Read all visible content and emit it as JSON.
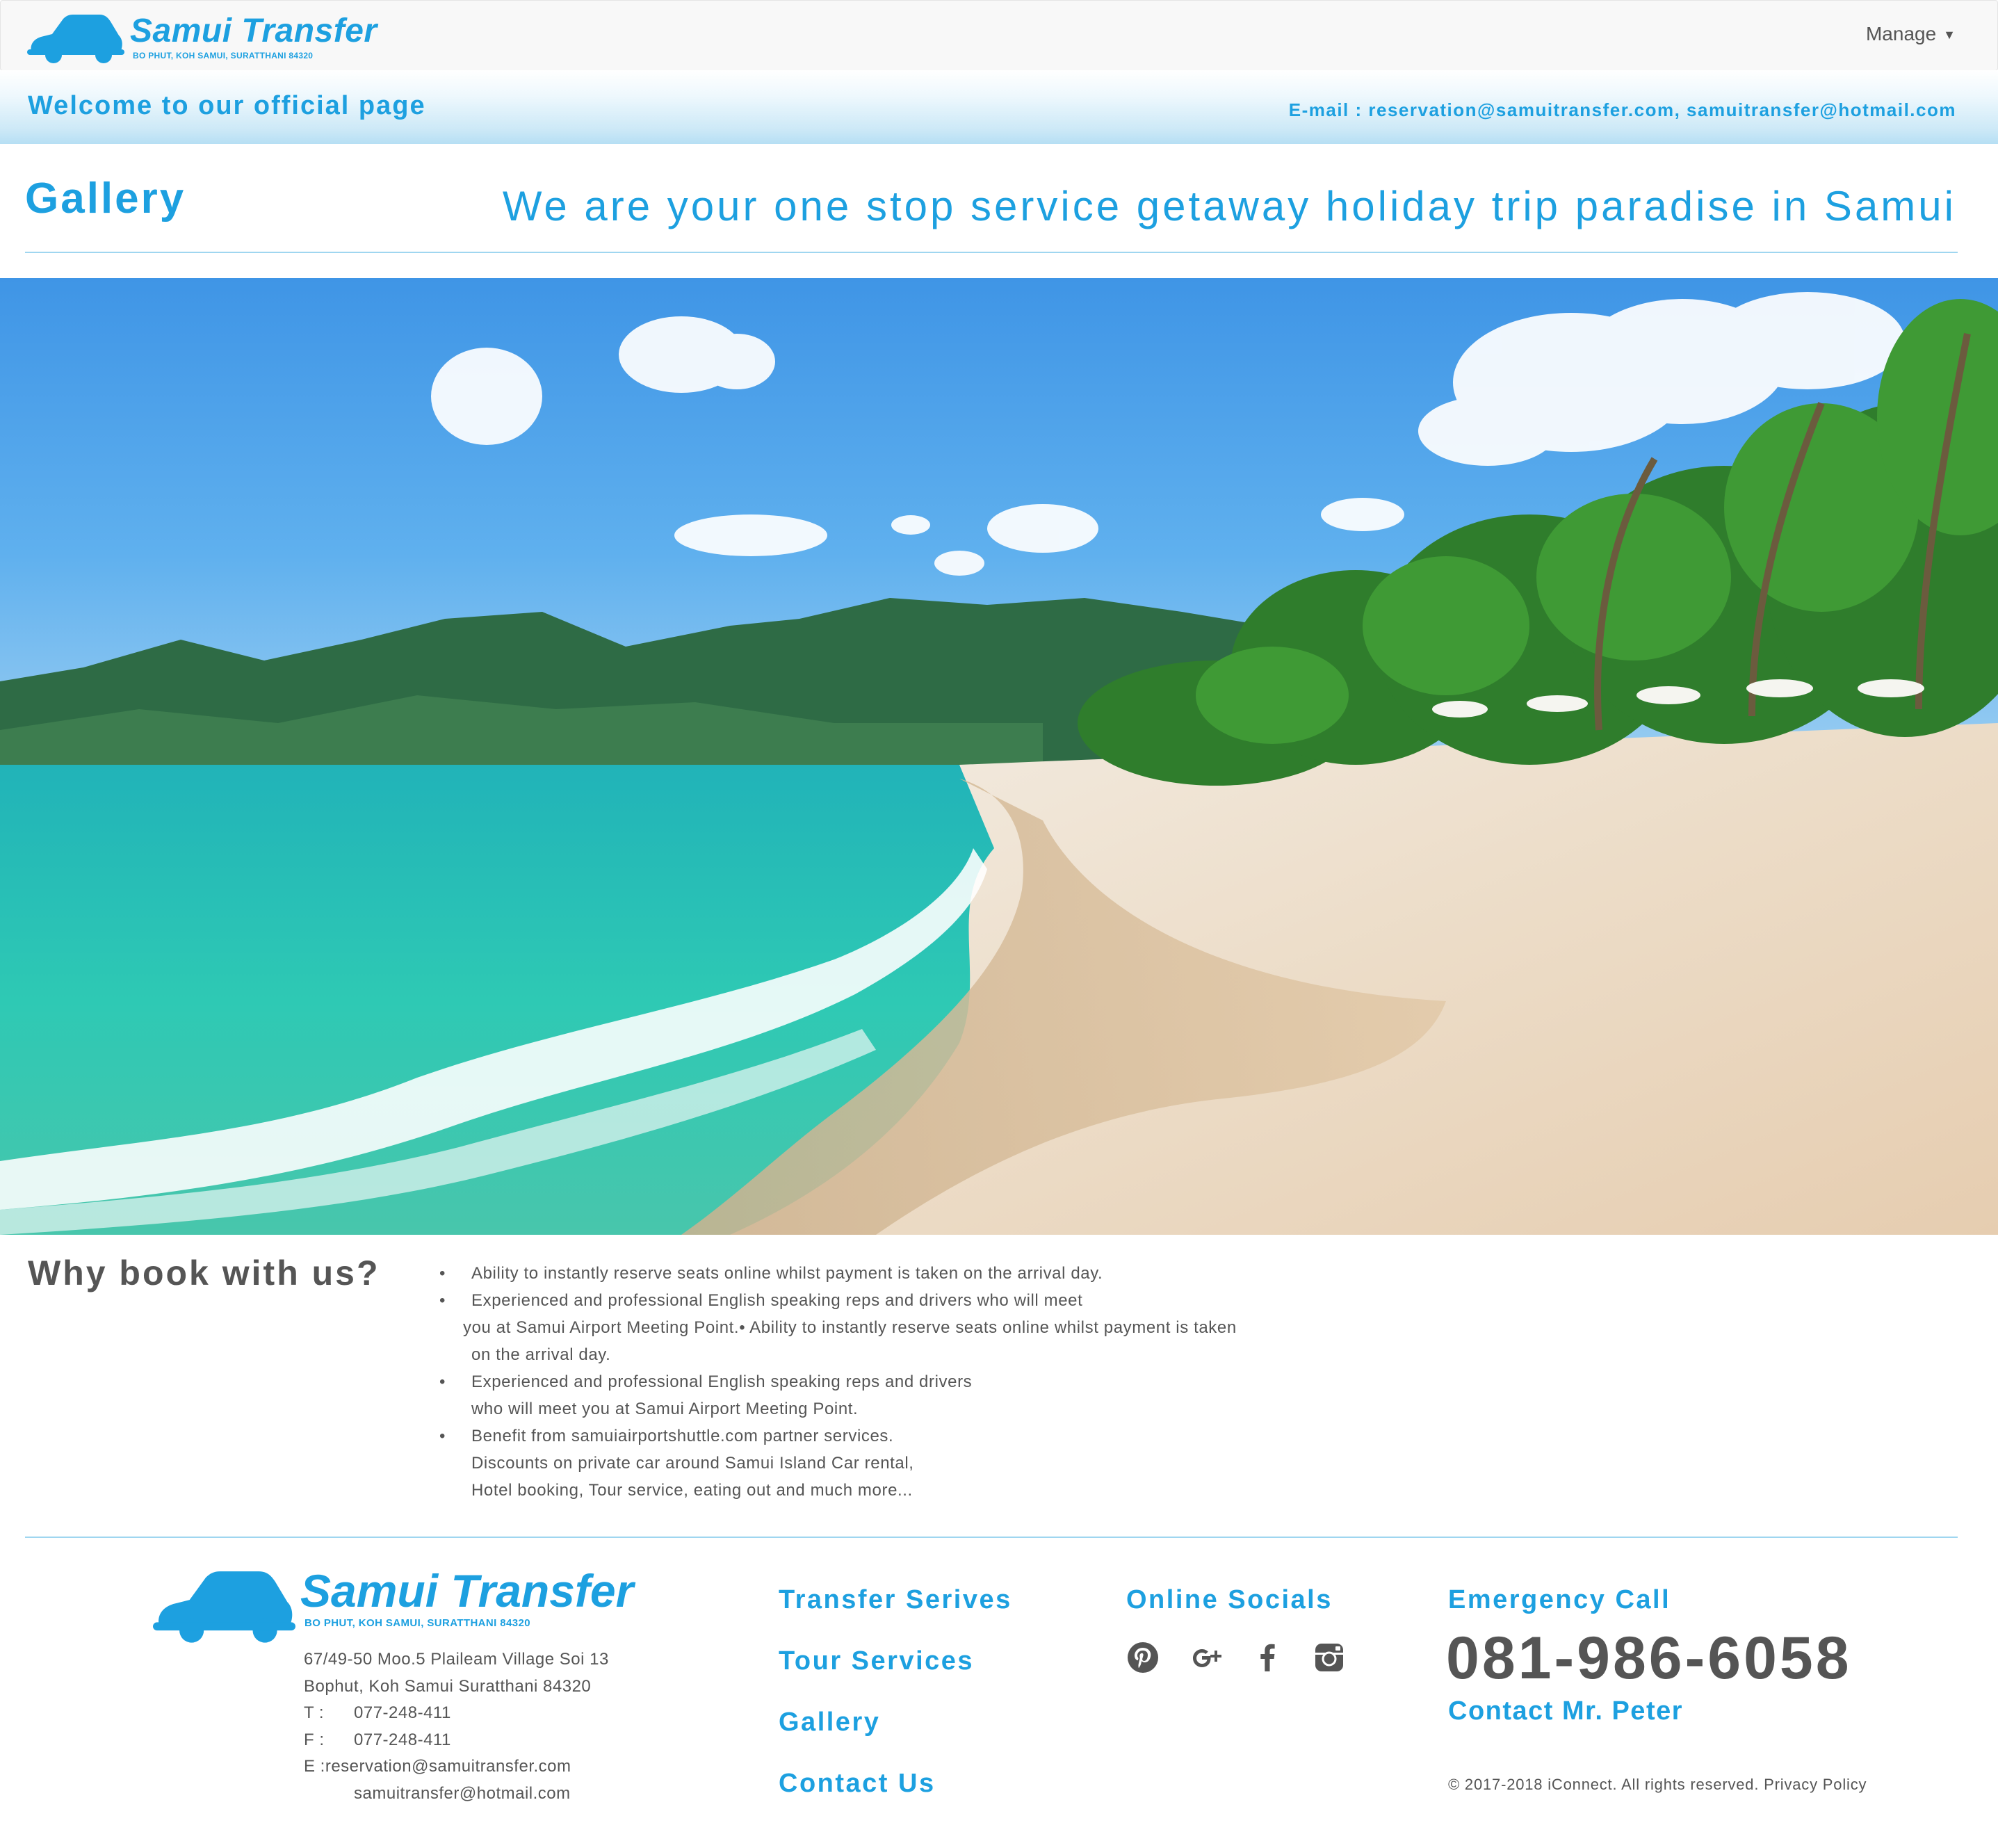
{
  "navbar": {
    "brand_name": "Samui Transfer",
    "brand_address": "BO PHUT, KOH SAMUI, SURATTHANI 84320",
    "manage_label": "Manage",
    "manage_icon": "caret-down-icon"
  },
  "welcome": {
    "message": "Welcome to our official page",
    "email_line": "E-mail : reservation@samuitransfer.com, samuitransfer@hotmail.com"
  },
  "header": {
    "title": "Gallery",
    "tagline": "We are your one stop service getaway holiday trip paradise in Samui"
  },
  "why": {
    "title": "Why book with us?",
    "bullet": "•",
    "lines": [
      "Ability to instantly reserve seats online whilst payment is taken on the arrival day.",
      "Experienced and professional English speaking reps and drivers who will meet",
      "you at Samui Airport Meeting Point.•    Ability to instantly reserve seats online whilst payment is taken",
      "on the arrival day.",
      "Experienced and professional English speaking reps and drivers",
      "who will meet you at Samui Airport Meeting Point.",
      "Benefit from samuiairportshuttle.com partner services.",
      "Discounts on private car around Samui Island Car rental,",
      "Hotel booking, Tour service, eating out and much more..."
    ]
  },
  "footer": {
    "brand_name": "Samui Transfer",
    "brand_address": "BO PHUT, KOH SAMUI, SURATTHANI 84320",
    "address_line1": "67/49-50 Moo.5 Plaileam Village Soi 13",
    "address_line2": "Bophut, Koh Samui Suratthani 84320",
    "tel_label": "T :",
    "tel": "077-248-411",
    "fax_label": "F :",
    "fax": "077-248-411",
    "email_label": "E :",
    "email1": "reservation@samuitransfer.com",
    "email2": "samuitransfer@hotmail.com",
    "links": [
      "Transfer Serives",
      "Tour Services",
      "Gallery",
      "Contact Us"
    ],
    "socials_title": "Online Socials",
    "social_icons": [
      "pinterest-icon",
      "google-plus-icon",
      "facebook-icon",
      "instagram-icon"
    ],
    "emergency_title": "Emergency Call",
    "phone": "081-986-6058",
    "contact_name": "Contact Mr. Peter",
    "copyright": "© 2017-2018 iConnect.  All rights reserved. Privacy Policy"
  },
  "colors": {
    "brand_blue": "#1da0e0",
    "text_gray": "#555555",
    "rule_blue": "#9fd6f0"
  }
}
